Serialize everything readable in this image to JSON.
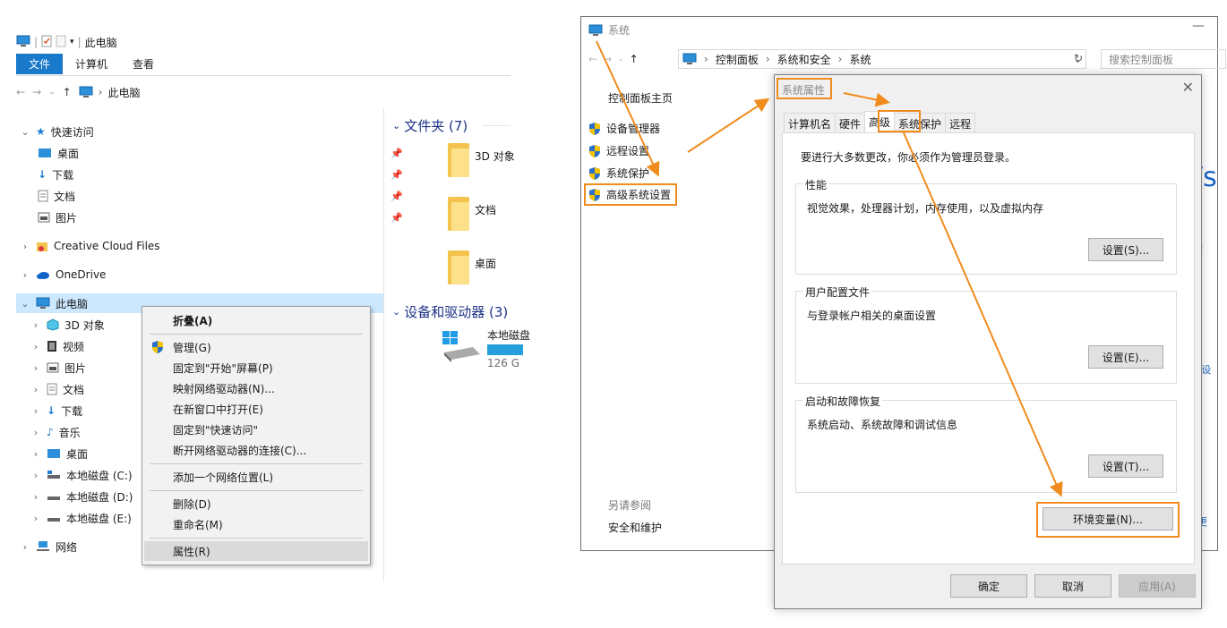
{
  "explorer": {
    "title": "此电脑",
    "ribbon_tabs": [
      "文件",
      "计算机",
      "查看"
    ],
    "address_crumb": "此电脑",
    "nav": {
      "quick_access": "快速访问",
      "qa_items": [
        "桌面",
        "下载",
        "文档",
        "图片"
      ],
      "creative_cloud": "Creative Cloud Files",
      "onedrive": "OneDrive",
      "this_pc": "此电脑",
      "pc_items": [
        "3D 对象",
        "视频",
        "图片",
        "文档",
        "下载",
        "音乐",
        "桌面",
        "本地磁盘 (C:)",
        "本地磁盘 (D:)",
        "本地磁盘 (E:)"
      ],
      "network": "网络"
    },
    "content": {
      "folders_group": "文件夹 (7)",
      "folders": [
        "3D 对象",
        "文档",
        "桌面"
      ],
      "devices_group": "设备和驱动器 (3)",
      "drive_name": "本地磁盘",
      "drive_size": "126 G"
    }
  },
  "context_menu": {
    "items": [
      "折叠(A)",
      "管理(G)",
      "固定到\"开始\"屏幕(P)",
      "映射网络驱动器(N)...",
      "在新窗口中打开(E)",
      "固定到\"快速访问\"",
      "断开网络驱动器的连接(C)...",
      "添加一个网络位置(L)",
      "删除(D)",
      "重命名(M)",
      "属性(R)"
    ]
  },
  "system": {
    "title": "系统",
    "breadcrumb": [
      "控制面板",
      "系统和安全",
      "系统"
    ],
    "search_placeholder": "搜索控制面板",
    "home_link": "控制面板主页",
    "side_links": [
      "设备管理器",
      "远程设置",
      "系统保护",
      "高级系统设置"
    ],
    "see_also": "另请参阅",
    "see_also_link": "安全和维护"
  },
  "dialog": {
    "title": "系统属性",
    "tabs": [
      "计算机名",
      "硬件",
      "高级",
      "系统保护",
      "远程"
    ],
    "admin_note": "要进行大多数更改，你必须作为管理员登录。",
    "performance": {
      "legend": "性能",
      "desc": "视觉效果，处理器计划，内存使用，以及虚拟内存",
      "button": "设置(S)..."
    },
    "profiles": {
      "legend": "用户配置文件",
      "desc": "与登录帐户相关的桌面设置",
      "button": "设置(E)..."
    },
    "startup": {
      "legend": "启动和故障恢复",
      "desc": "系统启动、系统故障和调试信息",
      "button": "设置(T)..."
    },
    "env_button": "环境变量(N)...",
    "ok": "确定",
    "cancel": "取消",
    "apply": "应用(A)"
  },
  "colors": {
    "accent": "#1979ca",
    "highlight": "#f08c1e",
    "selection": "#cce8ff"
  }
}
